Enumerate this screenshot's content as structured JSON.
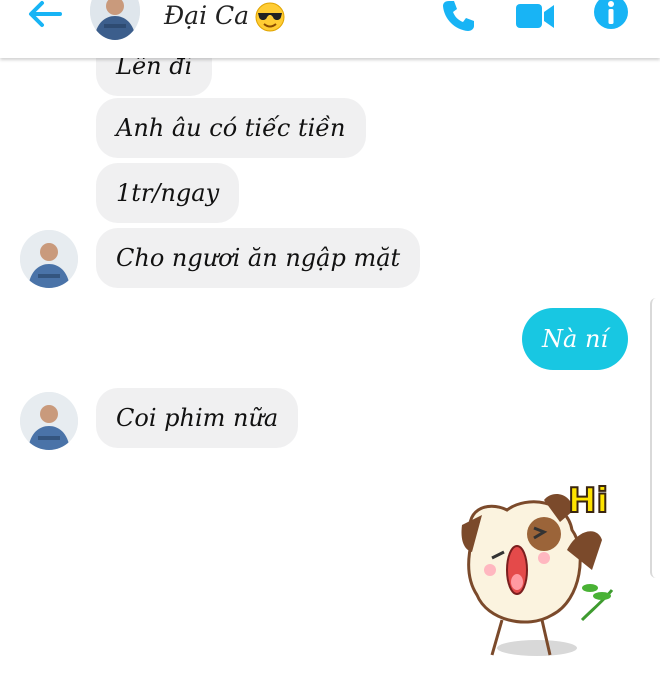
{
  "header": {
    "contact_name": "Đại Ca",
    "back_icon": "back-arrow-icon",
    "emoji_icon": "sunglasses-emoji-icon",
    "call_icon": "phone-icon",
    "video_icon": "video-camera-icon",
    "info_icon": "info-icon",
    "accent_color": "#18b4f5"
  },
  "messages": [
    {
      "from": "contact",
      "text": "Lên đi"
    },
    {
      "from": "contact",
      "text": "Anh âu có tiếc tiền"
    },
    {
      "from": "contact",
      "text": "1tr/ngay"
    },
    {
      "from": "contact",
      "text": "Cho ngươi ăn ngập mặt"
    },
    {
      "from": "me",
      "text": "Nà ní"
    },
    {
      "from": "contact",
      "text": "Coi phim nữa"
    }
  ],
  "sticker": {
    "icon": "hi-cat-sticker-icon",
    "text": "Hi"
  },
  "colors": {
    "incoming_bubble": "#f0f0f1",
    "outgoing_bubble": "#18c7e2"
  }
}
